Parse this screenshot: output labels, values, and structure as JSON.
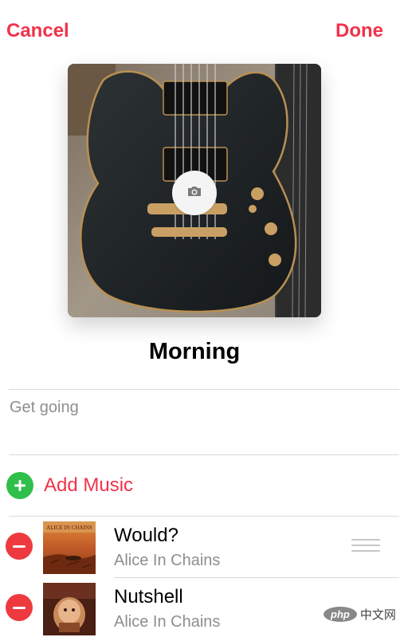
{
  "header": {
    "cancel_label": "Cancel",
    "done_label": "Done"
  },
  "playlist": {
    "title": "Morning",
    "description": "Get going",
    "artwork_icon": "camera-icon"
  },
  "add_music": {
    "label": "Add Music",
    "icon": "plus-icon",
    "icon_color": "#2fbf4b"
  },
  "tracks": [
    {
      "title": "Would?",
      "artist": "Alice In Chains",
      "album_thumb": "dirt-album-art"
    },
    {
      "title": "Nutshell",
      "artist": "Alice In Chains",
      "album_thumb": "jar-of-flies-album-art"
    }
  ],
  "watermark": {
    "logo": "php",
    "text": "中文网"
  },
  "colors": {
    "accent": "#f0334a",
    "remove": "#ee3a3f",
    "secondary_text": "#8e8e8e"
  }
}
